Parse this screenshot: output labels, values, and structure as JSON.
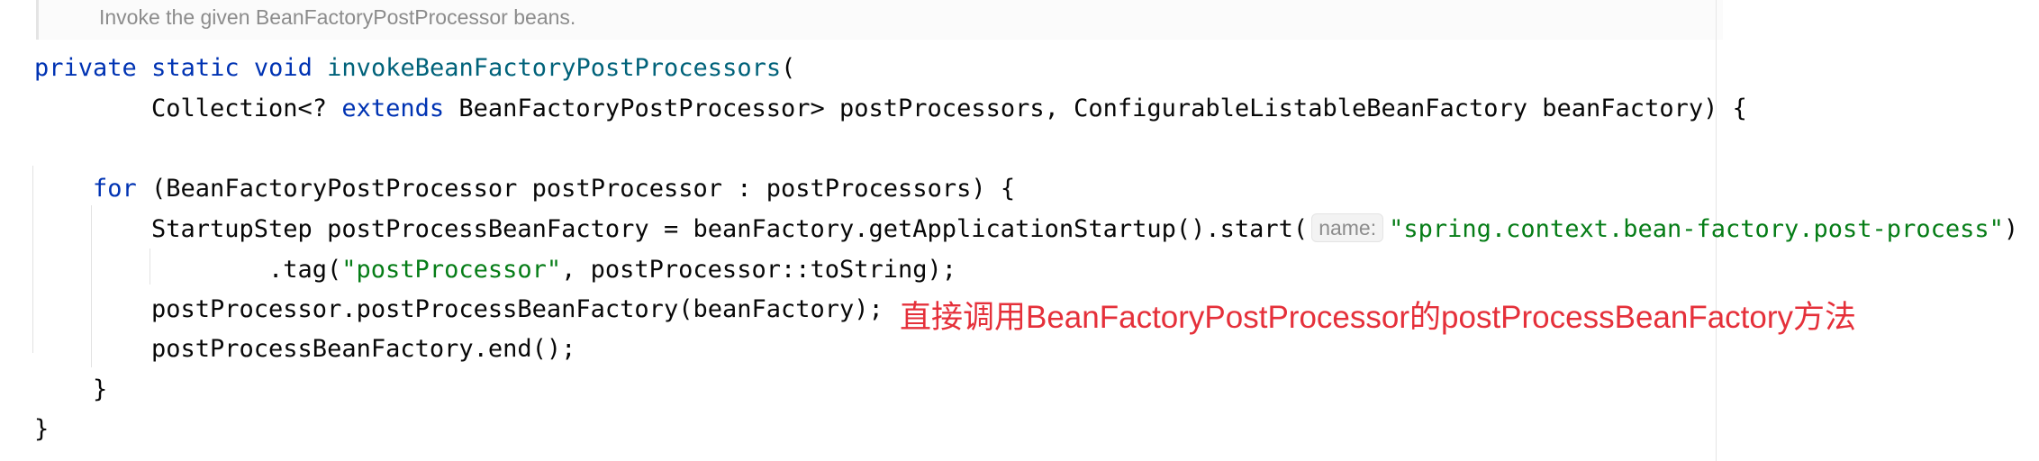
{
  "doc_comment": "Invoke the given BeanFactoryPostProcessor beans.",
  "code": {
    "line1": {
      "kw_private": "private",
      "kw_static": "static",
      "kw_void": "void",
      "method_name": "invokeBeanFactoryPostProcessors",
      "open_paren": "("
    },
    "line2": {
      "part1": "Collection<? ",
      "kw_extends": "extends",
      "part2": " BeanFactoryPostProcessor> postProcessors, ConfigurableListableBeanFactory beanFactory) {"
    },
    "line3": {
      "kw_for": "for",
      "rest": " (BeanFactoryPostProcessor postProcessor : postProcessors) {"
    },
    "line4": {
      "code_before_hint": "StartupStep postProcessBeanFactory = beanFactory.getApplicationStartup().start(",
      "param_hint": "name:",
      "string_arg": "\"spring.context.bean-factory.post-process\"",
      "close": ")"
    },
    "line5": {
      "code1": ".tag(",
      "string_arg": "\"postProcessor\"",
      "code2": ", postProcessor::toString);"
    },
    "line6": "postProcessor.postProcessBeanFactory(beanFactory);",
    "line7": "postProcessBeanFactory.end();",
    "line8": "}",
    "line9": "}"
  },
  "annotation": "直接调用BeanFactoryPostProcessor的postProcessBeanFactory方法",
  "colors": {
    "keyword": "#0033b3",
    "method_declaration": "#00627a",
    "string_literal": "#067d17",
    "annotation_text": "#e5303a",
    "doc_comment": "#8c8c8c"
  }
}
